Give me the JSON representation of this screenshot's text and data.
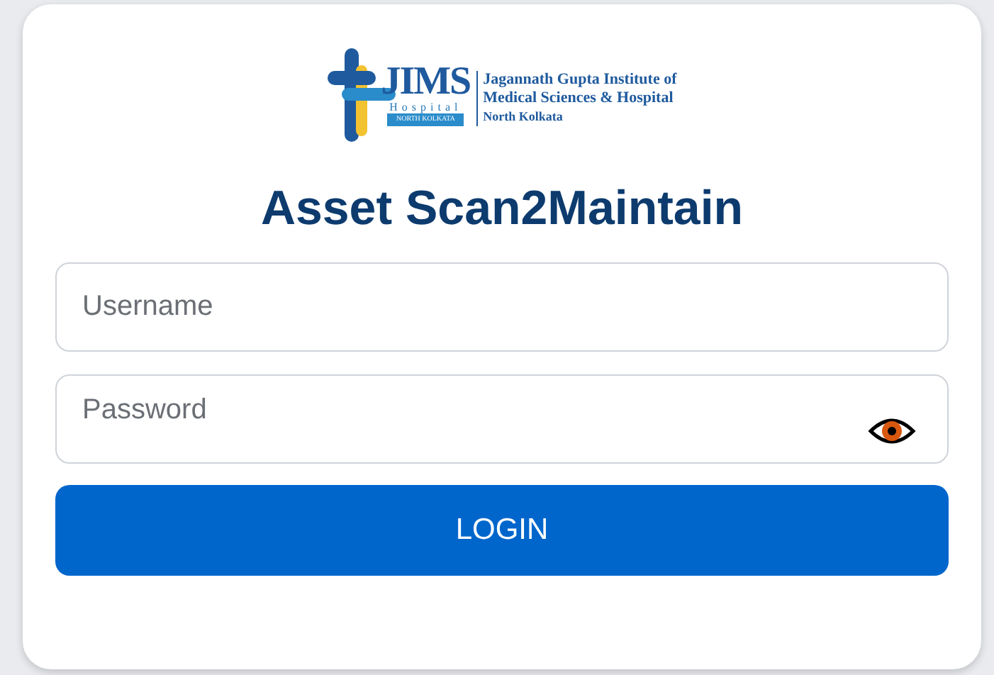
{
  "logo": {
    "mark": "JIMS",
    "sub": "Hospital",
    "band": "NORTH KOLKATA",
    "lines": [
      "Jagannath Gupta Institute of",
      "Medical Sciences & Hospital",
      "North Kolkata"
    ]
  },
  "title": "Asset Scan2Maintain",
  "username": {
    "placeholder": "Username"
  },
  "password": {
    "placeholder": "Password"
  },
  "button": "LOGIN"
}
